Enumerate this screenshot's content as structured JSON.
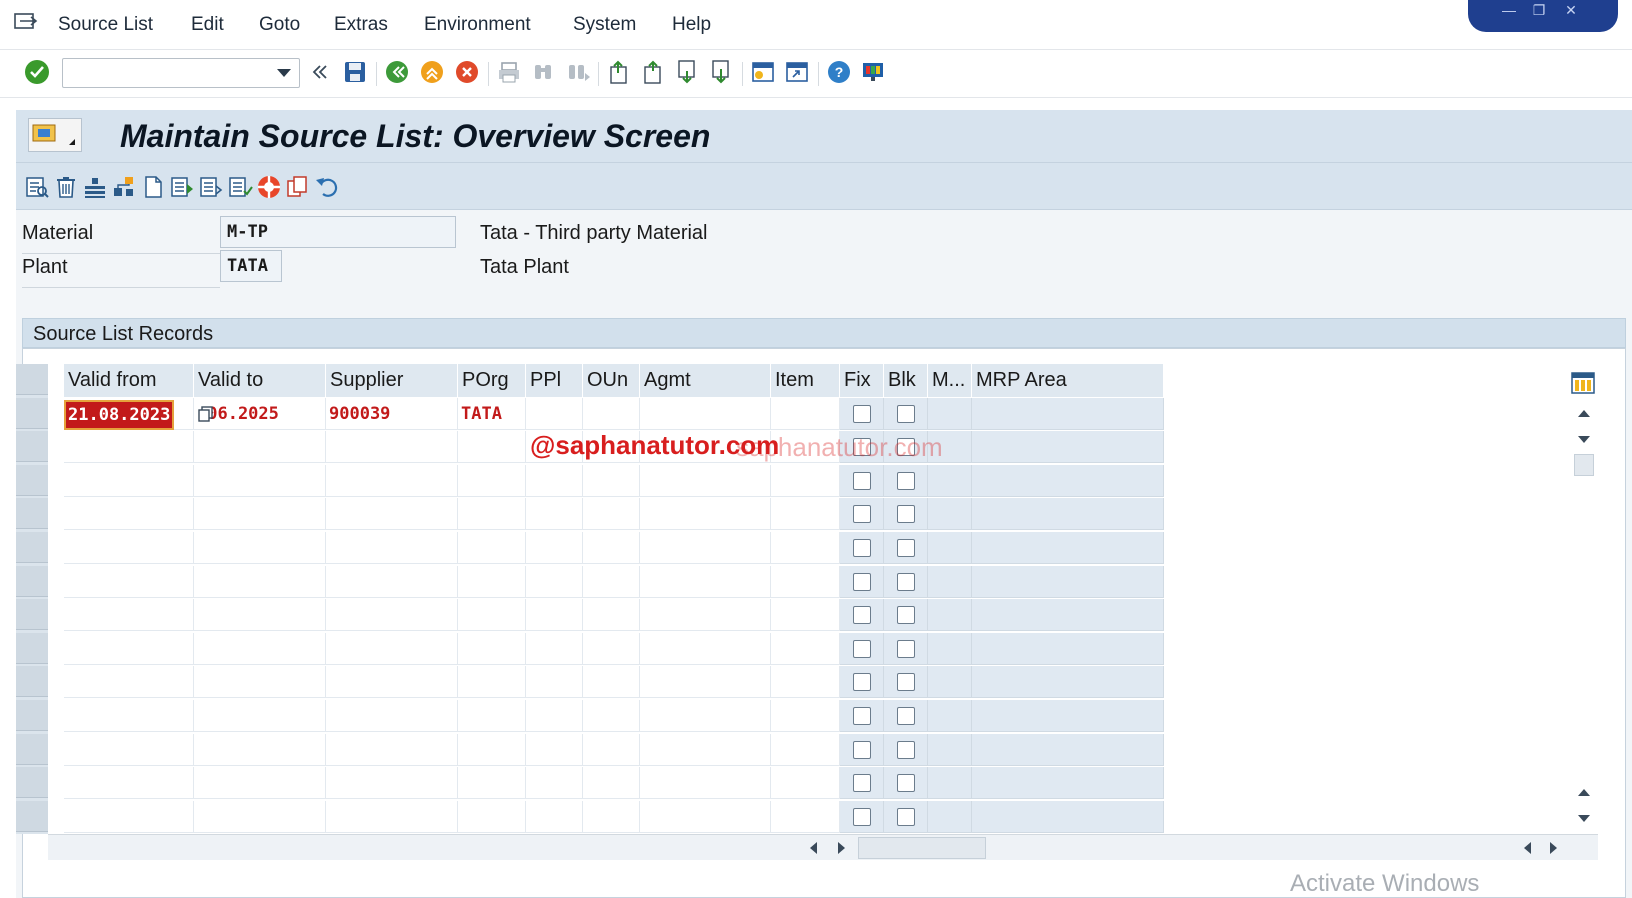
{
  "menu": {
    "items": [
      "Source List",
      "Edit",
      "Goto",
      "Extras",
      "Environment",
      "System",
      "Help"
    ]
  },
  "toolbar": {
    "command_value": "",
    "icons": [
      "enter-icon",
      "back-double-icon",
      "save-icon",
      "back-icon",
      "exit-icon",
      "cancel-icon",
      "print-icon",
      "find-icon",
      "find-next-icon",
      "first-page-icon",
      "previous-page-icon",
      "next-page-icon",
      "last-page-icon",
      "create-session-icon",
      "shortcut-icon",
      "help-icon",
      "layout-icon"
    ]
  },
  "page": {
    "title": "Maintain Source List: Overview Screen"
  },
  "header_fields": {
    "material_label": "Material",
    "material_value": "M-TP",
    "material_desc": "Tata - Third party Material",
    "plant_label": "Plant",
    "plant_value": "TATA",
    "plant_desc": "Tata Plant"
  },
  "table": {
    "group_title": "Source List Records",
    "columns": [
      "Valid from",
      "Valid to",
      "Supplier",
      "POrg",
      "PPl",
      "OUn",
      "Agmt",
      "Item",
      "Fix",
      "Blk",
      "M...",
      "MRP Area"
    ],
    "rows": [
      {
        "valid_from": "21.08.2023",
        "valid_to": ".06.2025",
        "supplier": "900039",
        "porg": "TATA",
        "ppl": "",
        "oun": "",
        "agmt": "",
        "item": "",
        "fix": false,
        "blk": false,
        "m": "",
        "mrp_area": ""
      }
    ],
    "empty_rows": 12
  },
  "watermark": {
    "text": "@saphanatutor.com",
    "ghost": "saphanatutor.com"
  },
  "os_notice": "Activate Windows",
  "colors": {
    "accent_red": "#c21a1a",
    "header_blue": "#d7e3ee"
  }
}
